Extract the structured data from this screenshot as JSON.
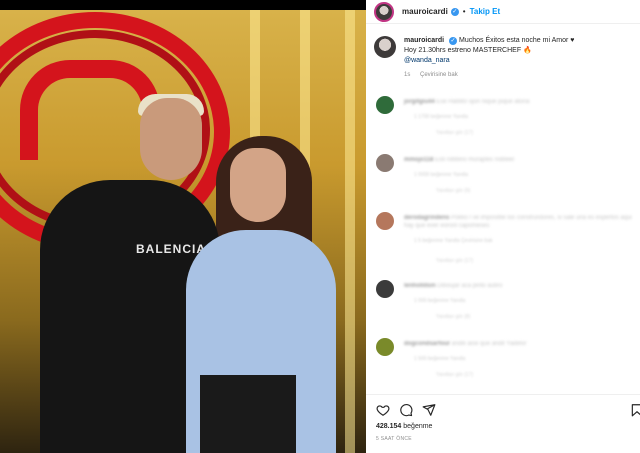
{
  "header": {
    "username": "mauroicardi",
    "verified_glyph": "✓",
    "separator": "•",
    "follow_label": "Takip Et"
  },
  "photo": {
    "shirt_text": "BALENCIAGA"
  },
  "caption": {
    "username": "mauroicardi",
    "line1": "Muchos Éxitos esta noche mi Amor ♥",
    "line2": "Hoy 21.30hrs estreno MASTERCHEF 🔥",
    "mention": "@wanda_nara",
    "age": "1s",
    "translate_label": "Çevirisine bak"
  },
  "comments": [
    {
      "user": "jorgitgiu44",
      "text": "Ese Hablito ojon nique pique atona",
      "meta": "1 1700 beğenme    Yanıtla",
      "replies": "Yanıtları gör (17)",
      "avatar_color": "#2f6b3a"
    },
    {
      "user": "mmojo118",
      "text": "Esti robbino muraples nobleel",
      "meta": "1 0000 beğenme    Yanıtla",
      "replies": "Yanıtları gör (9)",
      "avatar_color": "#8a7a72"
    },
    {
      "user": "derodagrindens",
      "text": "Pokko I ve impositlie los construistores, si sale una es expertos aqui hay que ever eoroni capomeses",
      "meta": "1 5 beğenme    Yanıtla    Çevirisine bak",
      "replies": "Yanıtları gör (17)",
      "avatar_color": "#b5775c"
    },
    {
      "user": "lenholldsin",
      "text": "Diboujar aca pinto autiro",
      "meta": "1 000 beğenme    Yanıtla",
      "replies": "Yanıtları gör (8)",
      "avatar_color": "#3b3b3b"
    },
    {
      "user": "dogcondsarfour",
      "text": "andili aise que andit  Yadelor",
      "meta": "1 500 beğenme    Yanıtla",
      "replies": "Yanıtları gör (17)",
      "avatar_color": "#7a8a2a"
    }
  ],
  "actions": {
    "likes_count": "428.154",
    "likes_label": "beğenme",
    "time": "5 SAAT ÖNCE"
  },
  "colors": {
    "accent": "#0095f6",
    "verified": "#3897f0",
    "masterchef_red": "#d4141c"
  },
  "icons": [
    "heart-icon",
    "comment-icon",
    "share-icon",
    "bookmark-icon",
    "verified-icon"
  ]
}
